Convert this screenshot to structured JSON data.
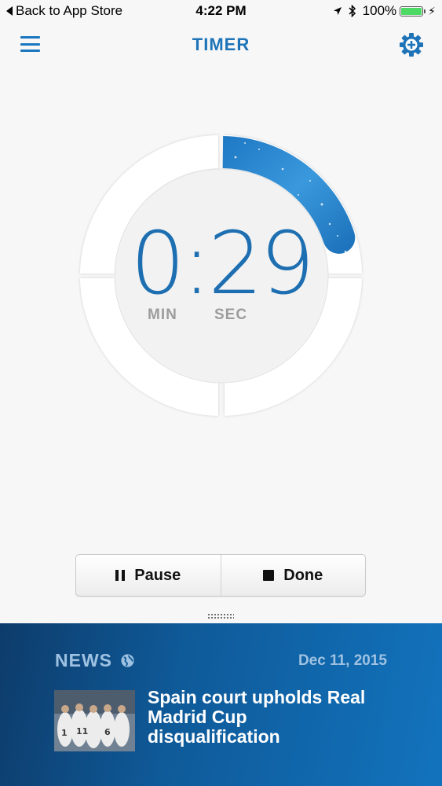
{
  "status_bar": {
    "back_label": "Back to App Store",
    "time": "4:22 PM",
    "battery": "100%"
  },
  "header": {
    "title": "TIMER",
    "icons": [
      "menu-icon",
      "settings-add-icon"
    ]
  },
  "timer": {
    "minutes": "0",
    "separator": ":",
    "seconds": "29",
    "min_label": "MIN",
    "sec_label": "SEC",
    "progress_fraction": 0.2,
    "accent_color": "#1d6fb1"
  },
  "controls": {
    "pause_label": "Pause",
    "done_label": "Done"
  },
  "news": {
    "section_label": "NEWS",
    "date": "Dec 11, 2015",
    "headline": "Spain court upholds Real Madrid Cup disqualification",
    "background_color": "#0f5a99"
  }
}
